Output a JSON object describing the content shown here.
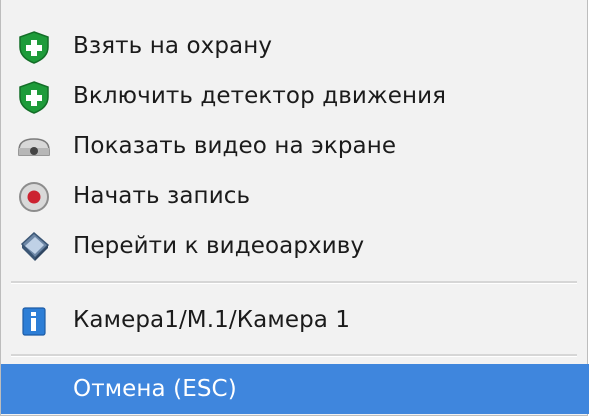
{
  "menu": {
    "items": [
      {
        "label": "Взять на охрану",
        "icon": "shield-plus-icon"
      },
      {
        "label": "Включить детектор движения",
        "icon": "shield-plus-icon"
      },
      {
        "label": "Показать видео на экране",
        "icon": "camera-icon"
      },
      {
        "label": "Начать запись",
        "icon": "record-icon"
      },
      {
        "label": "Перейти к видеоархиву",
        "icon": "archive-icon"
      },
      {
        "label": "Камера1/М.1/Камера 1",
        "icon": "info-icon"
      },
      {
        "label": "Отмена (ESC)",
        "icon": "none"
      }
    ]
  },
  "colors": {
    "menu_background": "#f2f2f2",
    "selection": "#3f86dd",
    "shield": "#1e9b3a",
    "record": "#cc2230",
    "info": "#2d7ed6",
    "archive": "#6d87a6"
  }
}
